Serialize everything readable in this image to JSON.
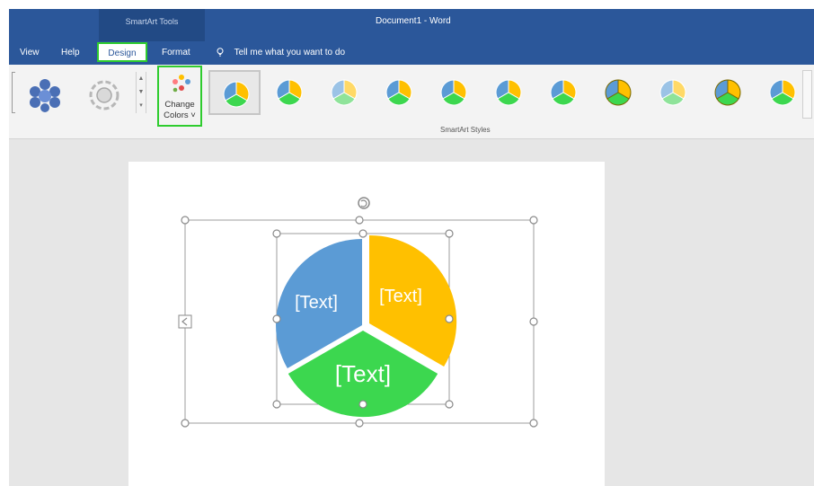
{
  "titlebar": {
    "context_tab": "SmartArt Tools",
    "document_title": "Document1 - Word"
  },
  "menubar": {
    "items": [
      {
        "label": "View"
      },
      {
        "label": "Help"
      },
      {
        "label": "Design"
      },
      {
        "label": "Format"
      }
    ],
    "tell_me": "Tell me what you want to do"
  },
  "ribbon": {
    "change_colors_line1": "Change",
    "change_colors_line2": "Colors ˅",
    "group_label": "SmartArt Styles",
    "style_count": 11,
    "selected_style_index": 0
  },
  "smartart": {
    "segments": [
      {
        "text": "[Text]",
        "color": "#5b9bd5"
      },
      {
        "text": "[Text]",
        "color": "#ffc000"
      },
      {
        "text": "[Text]",
        "color": "#3cd74f"
      }
    ]
  },
  "colors": {
    "word_blue": "#2b579a",
    "highlight_green": "#2ecc2e"
  }
}
